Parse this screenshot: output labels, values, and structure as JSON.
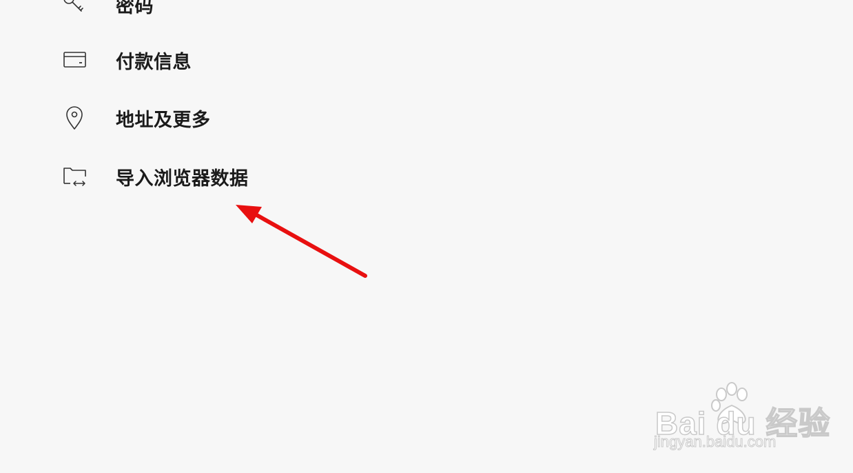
{
  "menu": {
    "items": [
      {
        "label": "密码",
        "icon": "key-icon"
      },
      {
        "label": "付款信息",
        "icon": "credit-card-icon"
      },
      {
        "label": "地址及更多",
        "icon": "location-pin-icon"
      },
      {
        "label": "导入浏览器数据",
        "icon": "folder-import-icon"
      }
    ]
  },
  "annotation": {
    "arrow_color": "#e81010"
  },
  "watermark": {
    "brand": "Bai du 经验",
    "url": "jingyan.baidu.com"
  }
}
